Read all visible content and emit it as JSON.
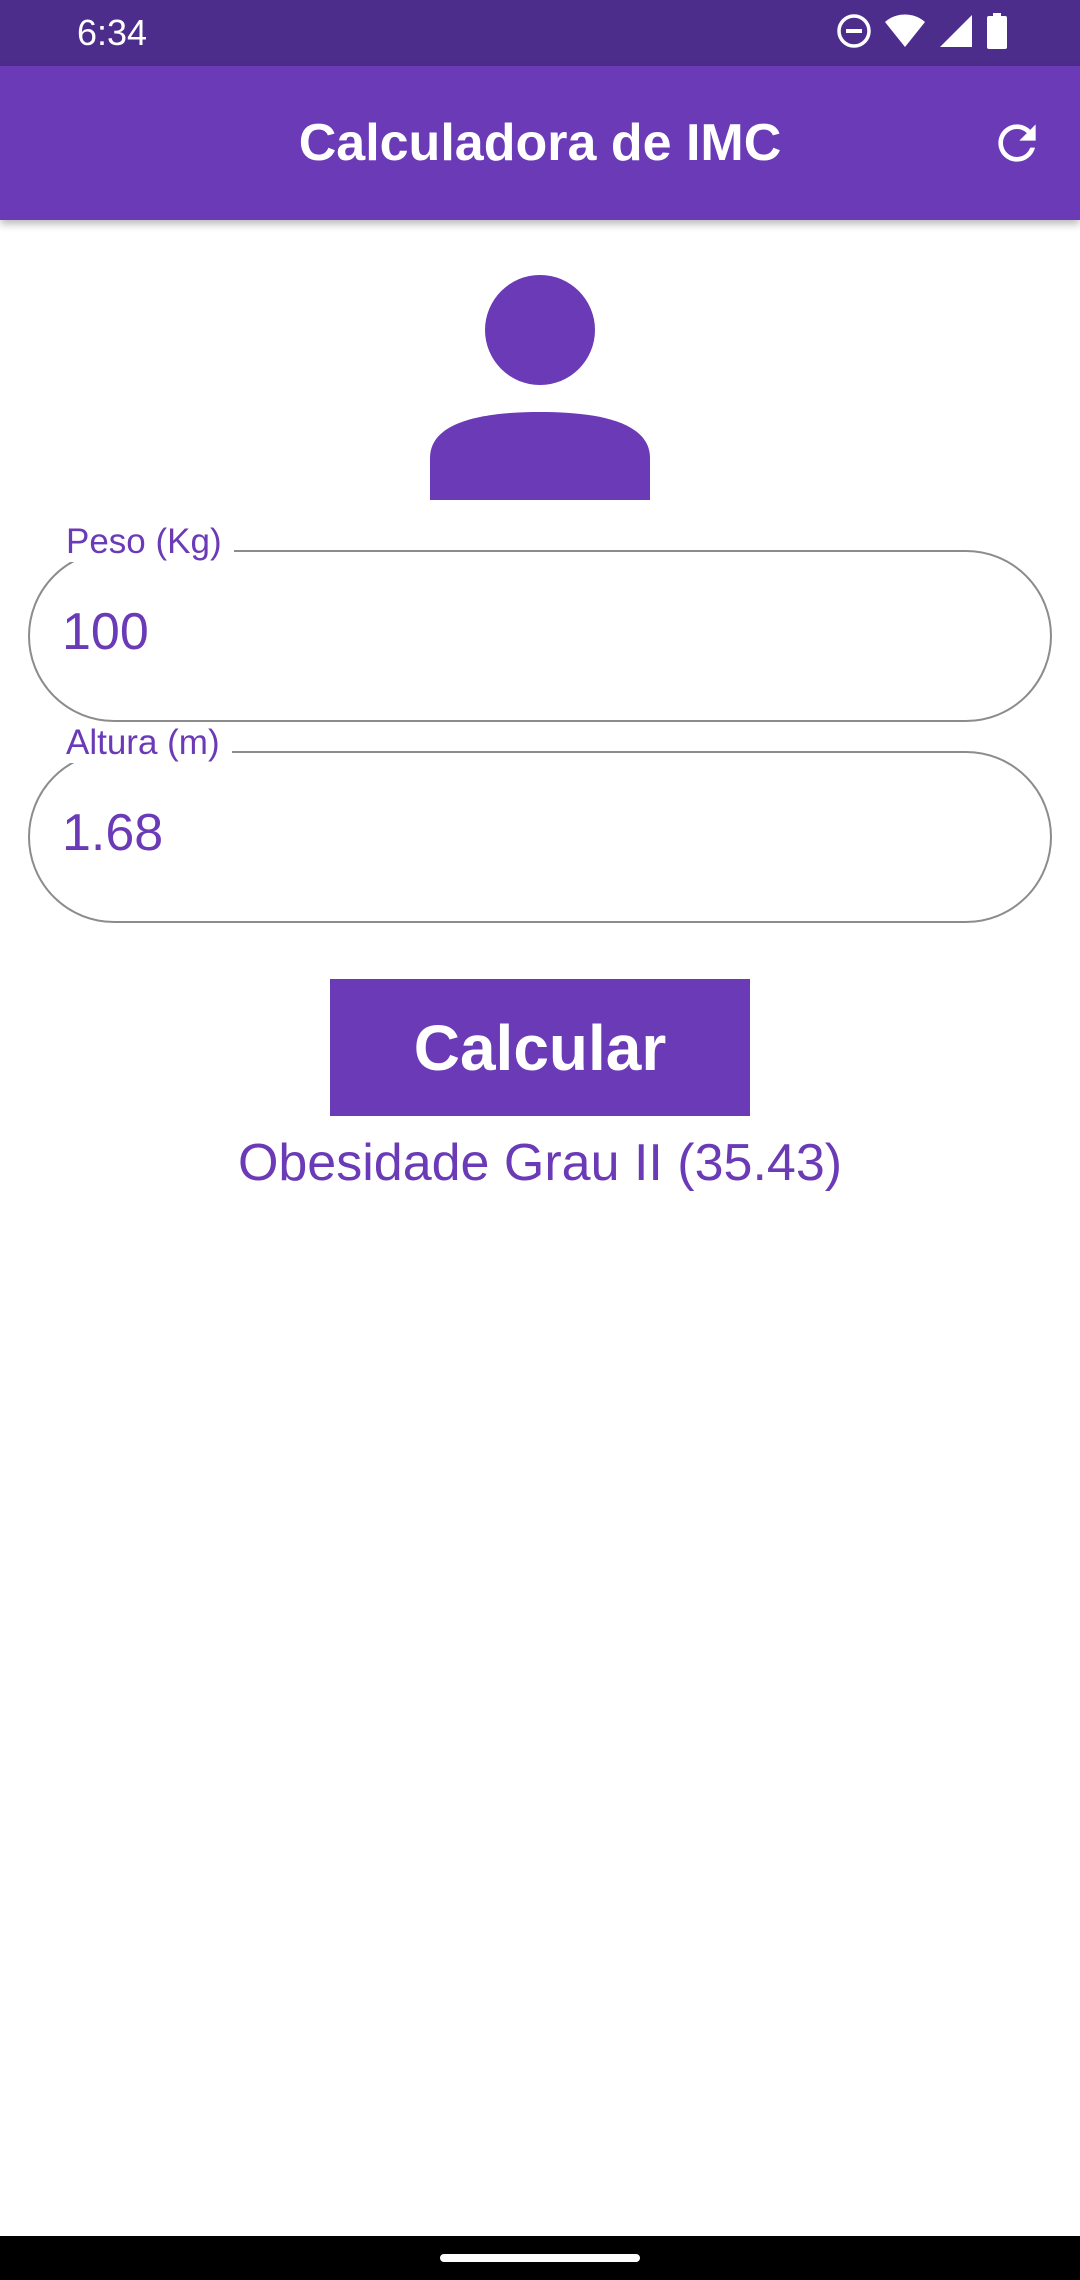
{
  "status_bar": {
    "time": "6:34",
    "icons": [
      "do-not-disturb-icon",
      "wifi-icon",
      "cell-signal-icon",
      "battery-icon"
    ]
  },
  "app_bar": {
    "title": "Calculadora de IMC",
    "refresh_icon": "refresh-icon"
  },
  "main": {
    "avatar_icon": "person-icon",
    "weight_field": {
      "label": "Peso (Kg)",
      "value": "100"
    },
    "height_field": {
      "label": "Altura (m)",
      "value": "1.68"
    },
    "calculate_button": "Calcular",
    "result": "Obesidade Grau II (35.43)"
  },
  "colors": {
    "primary": "#6a3ab7",
    "status_bar": "#4d2d8c",
    "border": "#8c8c8c",
    "background": "#ffffff"
  }
}
